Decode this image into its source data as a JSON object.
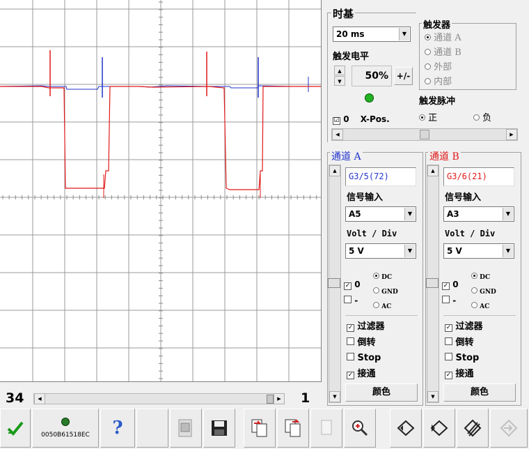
{
  "colors": {
    "channel_a": "#2233cc",
    "channel_b": "#e01818",
    "led_green": "#22b222",
    "check_green": "#1a9a1a",
    "help_blue": "#2a5cc8"
  },
  "timebase": {
    "title": "时基",
    "value": "20 ms"
  },
  "trigger_level": {
    "label": "触发电平",
    "value": "50",
    "unit": "%",
    "plusminus": "+/-",
    "xpos_check": "☑",
    "xpos_value": "0",
    "xpos_label": "X-Pos."
  },
  "trigger": {
    "title": "触发器",
    "sources": [
      "通道 A",
      "通道 B",
      "外部",
      "内部"
    ],
    "pulse_title": "触发脉冲",
    "pos": "正",
    "neg": "负"
  },
  "channel_a": {
    "title": "通道 A",
    "signal": "G3/5(72)",
    "input_label": "信号输入",
    "input": "A5",
    "volt_label": "Volt / Div",
    "volt": "5 V",
    "offset": "0",
    "coupling": [
      "DC",
      "GND",
      "AC"
    ],
    "minus": "-",
    "filter": "过滤器",
    "invert": "倒转",
    "stop": "Stop",
    "connect": "接通",
    "color_btn": "颜色"
  },
  "channel_b": {
    "title": "通道 B",
    "signal": "G3/6(21)",
    "input_label": "信号输入",
    "input": "A3",
    "volt_label": "Volt / Div",
    "volt": "5 V",
    "offset": "0",
    "coupling": [
      "DC",
      "GND",
      "AC"
    ],
    "minus": "-",
    "filter": "过滤器",
    "invert": "倒转",
    "stop": "Stop",
    "connect": "接通",
    "color_btn": "颜色"
  },
  "bottom": {
    "left_number": "34",
    "right_number": "1",
    "device_id": "0050B61518EC"
  },
  "toolbar": {
    "help": "?"
  }
}
